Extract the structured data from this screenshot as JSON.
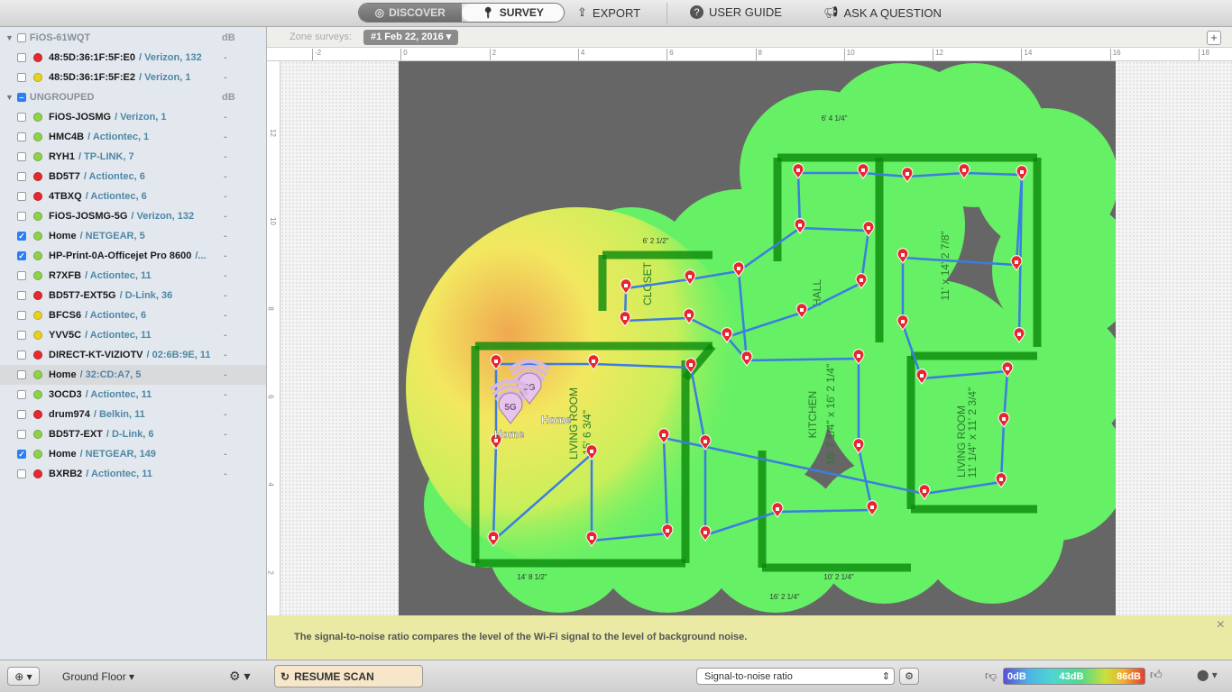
{
  "toolbar": {
    "discover": "DISCOVER",
    "survey": "SURVEY",
    "export": "EXPORT",
    "user_guide": "USER GUIDE",
    "ask": "ASK A QUESTION",
    "active_mode": "SURVEY"
  },
  "zone": {
    "label": "Zone surveys:",
    "selected": "#1 Feb 22, 2016",
    "add": "+"
  },
  "ruler": {
    "top": [
      "-2",
      "0",
      "2",
      "4",
      "6",
      "8",
      "10",
      "12",
      "14",
      "16",
      "18"
    ],
    "left": [
      "12",
      "10",
      "8",
      "6",
      "4",
      "2"
    ]
  },
  "sidebar": {
    "groups": [
      {
        "name": "FiOS-61WQT",
        "unit": "dB",
        "checkbox": "unchecked",
        "items": [
          {
            "name": "48:5D:36:1F:5F:E0",
            "vendor": "/ Verizon, 132",
            "status": "red",
            "checked": false,
            "value": "-"
          },
          {
            "name": "48:5D:36:1F:5F:E2",
            "vendor": "/ Verizon, 1",
            "status": "yellow",
            "checked": false,
            "value": "-"
          }
        ]
      },
      {
        "name": "UNGROUPED",
        "unit": "dB",
        "checkbox": "mixed",
        "items": [
          {
            "name": "FiOS-JOSMG",
            "vendor": "/ Verizon, 1",
            "status": "green",
            "checked": false,
            "value": "-"
          },
          {
            "name": "HMC4B",
            "vendor": "/ Actiontec, 1",
            "status": "green",
            "checked": false,
            "value": "-"
          },
          {
            "name": "RYH1",
            "vendor": "/ TP-LINK, 7",
            "status": "green",
            "checked": false,
            "value": "-"
          },
          {
            "name": "BD5T7",
            "vendor": "/ Actiontec, 6",
            "status": "red",
            "checked": false,
            "value": "-"
          },
          {
            "name": "4TBXQ",
            "vendor": "/ Actiontec, 6",
            "status": "red",
            "checked": false,
            "value": "-"
          },
          {
            "name": "FiOS-JOSMG-5G",
            "vendor": "/ Verizon, 132",
            "status": "green",
            "checked": false,
            "value": "-"
          },
          {
            "name": "Home",
            "vendor": "/ NETGEAR, 5",
            "status": "green",
            "checked": true,
            "value": "-"
          },
          {
            "name": "HP-Print-0A-Officejet Pro 8600",
            "vendor": "/...",
            "status": "green",
            "checked": true,
            "value": "-"
          },
          {
            "name": "R7XFB",
            "vendor": "/ Actiontec, 11",
            "status": "green",
            "checked": false,
            "value": "-"
          },
          {
            "name": "BD5T7-EXT5G",
            "vendor": "/ D-Link, 36",
            "status": "red",
            "checked": false,
            "value": "-"
          },
          {
            "name": "BFCS6",
            "vendor": "/ Actiontec, 6",
            "status": "yellow",
            "checked": false,
            "value": "-"
          },
          {
            "name": "YVV5C",
            "vendor": "/ Actiontec, 11",
            "status": "yellow",
            "checked": false,
            "value": "-"
          },
          {
            "name": "DIRECT-KT-VIZIOTV",
            "vendor": "/ 02:6B:9E, 11",
            "status": "red",
            "checked": false,
            "value": "-"
          },
          {
            "name": "Home",
            "vendor": "/ 32:CD:A7, 5",
            "status": "green",
            "checked": false,
            "value": "-",
            "selected": true
          },
          {
            "name": "3OCD3",
            "vendor": "/ Actiontec, 11",
            "status": "green",
            "checked": false,
            "value": "-"
          },
          {
            "name": "drum974",
            "vendor": "/ Belkin, 11",
            "status": "red",
            "checked": false,
            "value": "-"
          },
          {
            "name": "BD5T7-EXT",
            "vendor": "/ D-Link, 6",
            "status": "green",
            "checked": false,
            "value": "-"
          },
          {
            "name": "Home",
            "vendor": "/ NETGEAR, 149",
            "status": "green",
            "checked": true,
            "value": "-"
          },
          {
            "name": "BXRB2",
            "vendor": "/ Actiontec, 11",
            "status": "red",
            "checked": false,
            "value": "-"
          }
        ]
      }
    ],
    "status_colors": {
      "green": "#8fd24a",
      "yellow": "#e8d21c",
      "red": "#e8282c"
    }
  },
  "plan": {
    "rooms": [
      "LIVING ROOM",
      "KITCHEN",
      "CLOSET",
      "HALL",
      "LIVING ROOM"
    ],
    "dimensions": [
      "15' 6 3/4\"",
      "14' 8 1/2\"",
      "16' 7 1/4\" x 16' 2 1/4\"",
      "11' x 14' 2 7/8\"",
      "11' 1/4\" x 11' 2 3/4\"",
      "16' 2 1/4\"",
      "10' 2 1/4\"",
      "6' 2 1/2\"",
      "6' 4 1/4\""
    ],
    "access_points": [
      {
        "label": "Home",
        "band": "5G"
      },
      {
        "label": "Home",
        "band": "5G"
      }
    ]
  },
  "banner": {
    "text": "The signal-to-noise ratio compares the level of the Wi-Fi signal to the level of background noise.",
    "close": "×"
  },
  "bottom": {
    "floor": "Ground Floor",
    "resume": "RESUME SCAN",
    "metric": "Signal-to-noise ratio",
    "legend": {
      "min": "0dB",
      "mid": "43dB",
      "max": "86dB"
    }
  }
}
